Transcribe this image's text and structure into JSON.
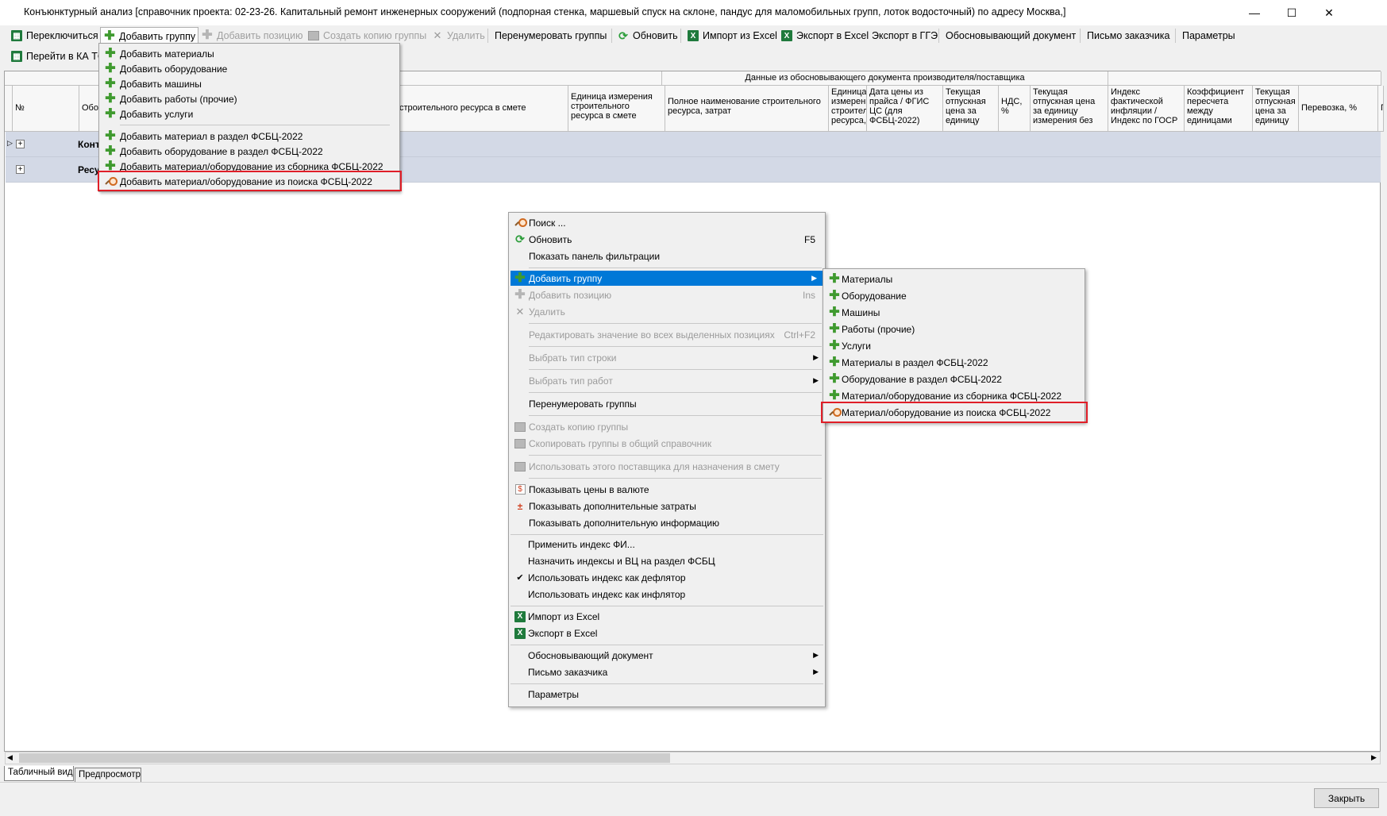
{
  "window": {
    "title": "Конъюнктурный анализ [справочник проекта: 02-23-26. Капитальный ремонт инженерных сооружений (подпорная стенка, маршевый спуск на склоне, пандус для маломобильных групп, лоток водосточный) по адресу Москва,]",
    "minimize": "—",
    "maximize": "☐",
    "close": "✕"
  },
  "toolbar": {
    "switch": "Переключиться",
    "add_group": "Добавить группу",
    "add_position": "Добавить позицию",
    "create_copy": "Создать копию группы",
    "delete": "Удалить",
    "renumber": "Перенумеровать группы",
    "refresh": "Обновить",
    "import_excel": "Импорт из Excel",
    "export_excel": "Экспорт в Excel",
    "export_gge": "Экспорт в ГГЭ",
    "justify_doc": "Обосновывающий документ",
    "customer_letter": "Письмо заказчика",
    "params": "Параметры",
    "go_ka_tsk": "Перейти в КА ТСК"
  },
  "grid": {
    "group_header": "Данные из обосновывающего документа производителя/поставщика",
    "columns": {
      "num": "№",
      "obos": "Обос",
      "resource_name": "строительного ресурса в смете",
      "unit": "Единица измерения строительного ресурса в смете",
      "full_name": "Полное наименование строительного ресурса, затрат",
      "unit2": "Единица измерения строительного ресурса,",
      "price_date": "Дата цены из прайса / ФГИС ЦС (для ФСБЦ-2022)",
      "cur_price": "Текущая отпускная цена за единицу",
      "vat": "НДС, %",
      "cur_price_unit": "Текущая отпускная цена за единицу измерения без",
      "index": "Индекс фактической инфляции / Индекс по ГОСР",
      "coef": "Коэффициент пересчета между единицами",
      "cur_price2": "Текущая отпускная цена за единицу",
      "transport": "Перевозка, %",
      "last": "П"
    },
    "rows": [
      {
        "label": "Конъ"
      },
      {
        "label": "Ресу"
      }
    ]
  },
  "add_group_menu": {
    "items": [
      "Добавить материалы",
      "Добавить оборудование",
      "Добавить машины",
      "Добавить работы (прочие)",
      "Добавить услуги",
      "Добавить материал в раздел ФСБЦ-2022",
      "Добавить оборудование в раздел ФСБЦ-2022",
      "Добавить материал/оборудование из сборника ФСБЦ-2022",
      "Добавить материал/оборудование из поиска ФСБЦ-2022"
    ]
  },
  "context_menu": {
    "search": "Поиск ...",
    "refresh": "Обновить",
    "refresh_shortcut": "F5",
    "show_filter": "Показать панель фильтрации",
    "add_group": "Добавить группу",
    "add_position": "Добавить позицию",
    "add_position_shortcut": "Ins",
    "delete": "Удалить",
    "edit_all": "Редактировать значение во всех выделенных позициях",
    "edit_all_shortcut": "Ctrl+F2",
    "row_type": "Выбрать тип строки",
    "work_type": "Выбрать тип работ",
    "renumber": "Перенумеровать группы",
    "create_copy": "Создать копию группы",
    "copy_to_common": "Скопировать группы в общий справочник",
    "use_supplier": "Использовать этого поставщика для назначения в смету",
    "show_currency": "Показывать цены в валюте",
    "show_extra_costs": "Показывать дополнительные затраты",
    "show_extra_info": "Показывать дополнительную информацию",
    "apply_index": "Применить индекс ФИ...",
    "assign_index": "Назначить индексы и ВЦ на раздел ФСБЦ",
    "use_deflator": "Использовать индекс как дефлятор",
    "use_inflator": "Использовать индекс как инфлятор",
    "check": "✔",
    "import_excel": "Импорт из Excel",
    "export_excel": "Экспорт в Excel",
    "justify_doc": "Обосновывающий документ",
    "customer_letter": "Письмо заказчика",
    "params": "Параметры",
    "arrow": "▶"
  },
  "submenu": {
    "items": [
      "Материалы",
      "Оборудование",
      "Машины",
      "Работы (прочие)",
      "Услуги",
      "Материалы в раздел ФСБЦ-2022",
      "Оборудование в раздел ФСБЦ-2022",
      "Материал/оборудование из сборника ФСБЦ-2022",
      "Материал/оборудование из поиска ФСБЦ-2022"
    ]
  },
  "tabs": {
    "table_view": "Табличный вид",
    "preview": "Предпросмотр"
  },
  "footer": {
    "close": "Закрыть"
  },
  "colors": {
    "highlight": "#0078d7",
    "annotation_red": "#e01e28",
    "row_bg": "#d3d9e6",
    "plus_green": "#3f9a2f"
  }
}
